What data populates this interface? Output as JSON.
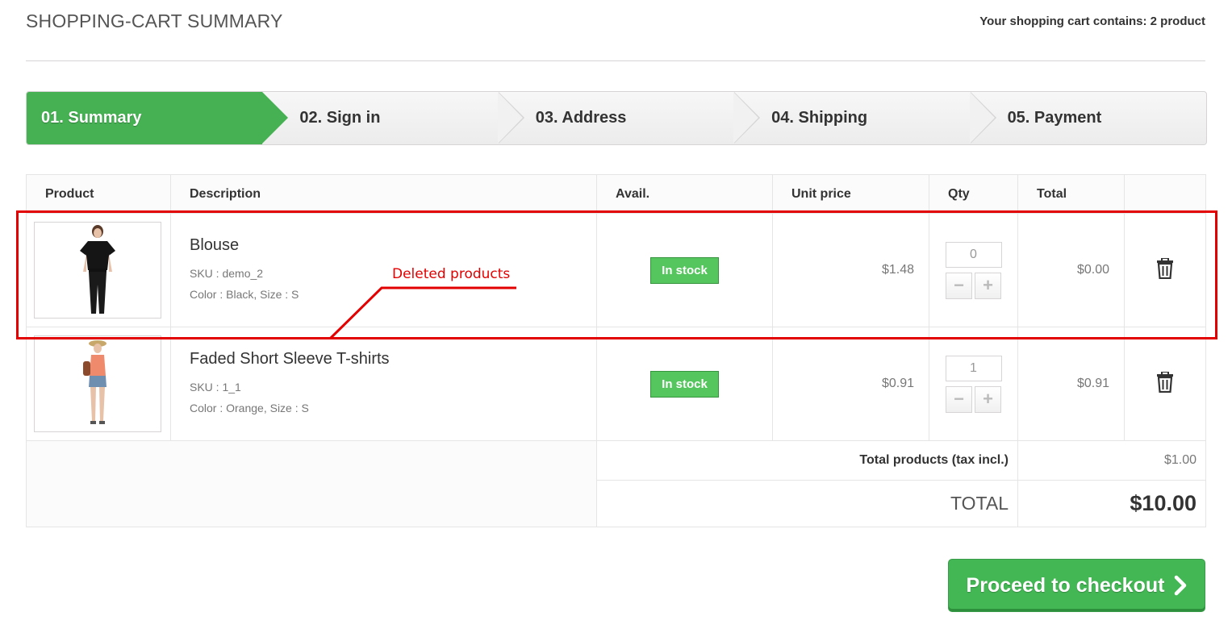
{
  "header": {
    "title": "SHOPPING-CART SUMMARY",
    "cart_count_text": "Your shopping cart contains: 2 product"
  },
  "steps": [
    {
      "label": "01. Summary",
      "active": true
    },
    {
      "label": "02. Sign in",
      "active": false
    },
    {
      "label": "03. Address",
      "active": false
    },
    {
      "label": "04. Shipping",
      "active": false
    },
    {
      "label": "05. Payment",
      "active": false
    }
  ],
  "table": {
    "columns": [
      "Product",
      "Description",
      "Avail.",
      "Unit price",
      "Qty",
      "Total",
      ""
    ],
    "rows": [
      {
        "name": "Blouse",
        "sku": "SKU : demo_2",
        "attrs": "Color : Black, Size : S",
        "availability": "In stock",
        "unit_price": "$1.48",
        "qty": "0",
        "total": "$0.00"
      },
      {
        "name": "Faded Short Sleeve T-shirts",
        "sku": "SKU : 1_1",
        "attrs": "Color : Orange, Size : S",
        "availability": "In stock",
        "unit_price": "$0.91",
        "qty": "1",
        "total": "$0.91"
      }
    ],
    "summary": {
      "products_label": "Total products (tax incl.)",
      "products_value": "$1.00",
      "total_label": "TOTAL",
      "total_value": "$10.00"
    }
  },
  "annotation": {
    "label": "Deleted products",
    "color": "#e30000"
  },
  "checkout": {
    "label": "Proceed to checkout"
  },
  "colors": {
    "accent_green": "#45b153",
    "stock_green": "#55c65e"
  }
}
